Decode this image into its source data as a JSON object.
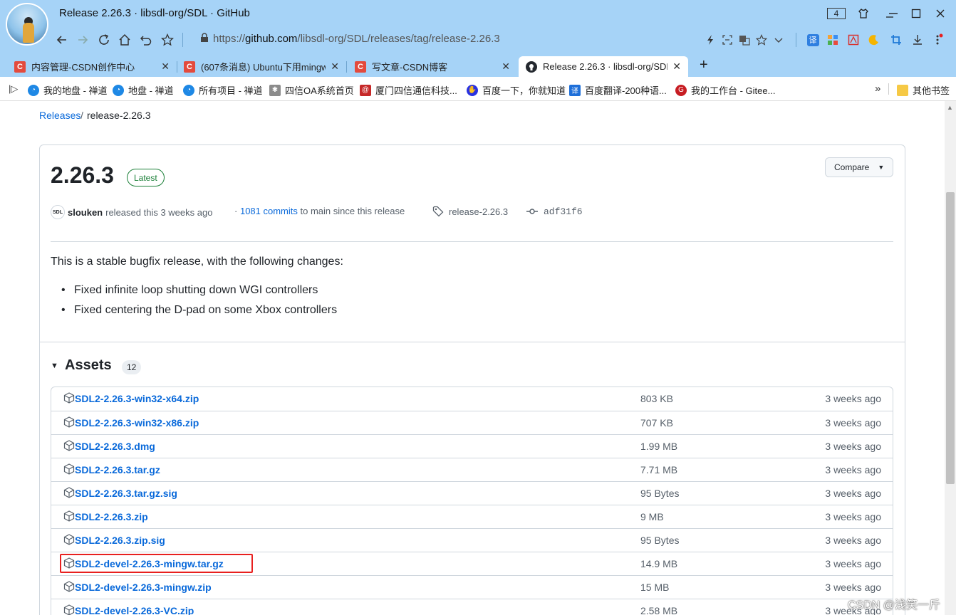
{
  "window": {
    "title": "Release 2.26.3 · libsdl-org/SDL · GitHub",
    "tab_count": "4"
  },
  "address_bar": {
    "url_prefix": "https://",
    "url_host": "github.com",
    "url_path": "/libsdl-org/SDL/releases/tag/release-2.26.3"
  },
  "tabs": [
    {
      "label": "内容管理-CSDN创作中心",
      "icon": "csdn-icon"
    },
    {
      "label": "(607条消息) Ubuntu下用mingw",
      "icon": "csdn-icon"
    },
    {
      "label": "写文章-CSDN博客",
      "icon": "csdn-icon"
    },
    {
      "label": "Release 2.26.3 · libsdl-org/SDL",
      "icon": "github-icon",
      "active": true
    }
  ],
  "bookmarks": [
    {
      "label": "我的地盘 - 禅道",
      "icon": "zentao-icon"
    },
    {
      "label": "地盘 - 禅道",
      "icon": "zentao-icon"
    },
    {
      "label": "所有项目 - 禅道",
      "icon": "zentao-icon"
    },
    {
      "label": "四信OA系统首页",
      "icon": "oa-icon"
    },
    {
      "label": "厦门四信通信科技...",
      "icon": "at-icon"
    },
    {
      "label": "百度一下，你就知道",
      "icon": "baidu-icon"
    },
    {
      "label": "百度翻译-200种语...",
      "icon": "translate-icon"
    },
    {
      "label": "我的工作台 - Gitee...",
      "icon": "gitee-icon"
    }
  ],
  "bookmarks_more": "»",
  "bookmarks_folder": "其他书签",
  "breadcrumb": {
    "releases": "Releases",
    "sep": "/",
    "tag": "release-2.26.3"
  },
  "release": {
    "version": "2.26.3",
    "badge": "Latest",
    "compare_label": "Compare",
    "avatar_text": "SDL",
    "author": "slouken",
    "released_text": "released this 3 weeks ago",
    "dot": "·",
    "commits_link": "1081 commits",
    "commits_suffix": "to main since this release",
    "tag": "release-2.26.3",
    "sha": "adf31f6",
    "description": "This is a stable bugfix release, with the following changes:",
    "changes": [
      "Fixed infinite loop shutting down WGI controllers",
      "Fixed centering the D-pad on some Xbox controllers"
    ]
  },
  "assets": {
    "title": "Assets",
    "count": "12",
    "items": [
      {
        "name": "SDL2-2.26.3-win32-x64.zip",
        "size": "803 KB",
        "date": "3 weeks ago"
      },
      {
        "name": "SDL2-2.26.3-win32-x86.zip",
        "size": "707 KB",
        "date": "3 weeks ago"
      },
      {
        "name": "SDL2-2.26.3.dmg",
        "size": "1.99 MB",
        "date": "3 weeks ago"
      },
      {
        "name": "SDL2-2.26.3.tar.gz",
        "size": "7.71 MB",
        "date": "3 weeks ago"
      },
      {
        "name": "SDL2-2.26.3.tar.gz.sig",
        "size": "95 Bytes",
        "date": "3 weeks ago"
      },
      {
        "name": "SDL2-2.26.3.zip",
        "size": "9 MB",
        "date": "3 weeks ago"
      },
      {
        "name": "SDL2-2.26.3.zip.sig",
        "size": "95 Bytes",
        "date": "3 weeks ago"
      },
      {
        "name": "SDL2-devel-2.26.3-mingw.tar.gz",
        "size": "14.9 MB",
        "date": "3 weeks ago"
      },
      {
        "name": "SDL2-devel-2.26.3-mingw.zip",
        "size": "15 MB",
        "date": "3 weeks ago"
      },
      {
        "name": "SDL2-devel-2.26.3-VC.zip",
        "size": "2.58 MB",
        "date": "3 weeks ago"
      }
    ]
  },
  "watermark": "CSDN @浅笑一斤",
  "colors": {
    "link": "#0969da",
    "latest": "#1a7f37",
    "highlight": "#e8201f",
    "chrome": "#a6d3f7"
  }
}
